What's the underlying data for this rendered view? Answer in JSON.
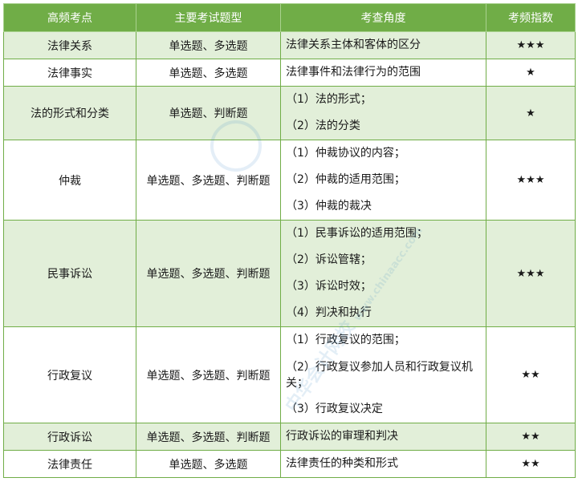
{
  "headers": [
    "高频考点",
    "主要考试题型",
    "考查角度",
    "考频指数"
  ],
  "rows": [
    {
      "topic": "法律关系",
      "types": "单选题、多选题",
      "angles": [
        "法律关系主体和客体的区分"
      ],
      "stars": "★★★",
      "shade": true
    },
    {
      "topic": "法律事实",
      "types": "单选题、多选题",
      "angles": [
        "法律事件和法律行为的范围"
      ],
      "stars": "★",
      "shade": false
    },
    {
      "topic": "法的形式和分类",
      "types": "单选题、判断题",
      "angles": [
        "（1）法的形式；",
        "（2）法的分类"
      ],
      "stars": "★",
      "shade": true
    },
    {
      "topic": "仲裁",
      "types": "单选题、多选题、判断题",
      "angles": [
        "（1）仲裁协议的内容；",
        "（2）仲裁的适用范围；",
        "（3）仲裁的裁决"
      ],
      "stars": "★★★",
      "shade": false
    },
    {
      "topic": "民事诉讼",
      "types": "单选题、多选题、判断题",
      "angles": [
        "（1）民事诉讼的适用范围；",
        "（2）诉讼管辖；",
        "（3）诉讼时效；",
        "（4）判决和执行"
      ],
      "stars": "★★★",
      "shade": true
    },
    {
      "topic": "行政复议",
      "types": "单选题、多选题、判断题",
      "angles": [
        "（1）行政复议的范围；",
        "（2）行政复议参加人员和行政复议机关；",
        "（3）行政复议决定"
      ],
      "stars": "★★",
      "shade": false
    },
    {
      "topic": "行政诉讼",
      "types": "单选题、多选题、判断题",
      "angles": [
        "行政诉讼的审理和判决"
      ],
      "stars": "★★",
      "shade": true
    },
    {
      "topic": "法律责任",
      "types": "单选题、多选题",
      "angles": [
        "法律责任的种类和形式"
      ],
      "stars": "★★",
      "shade": false
    }
  ],
  "watermark": {
    "text": "中华会计网校",
    "url": "www.chinaacc.com"
  }
}
